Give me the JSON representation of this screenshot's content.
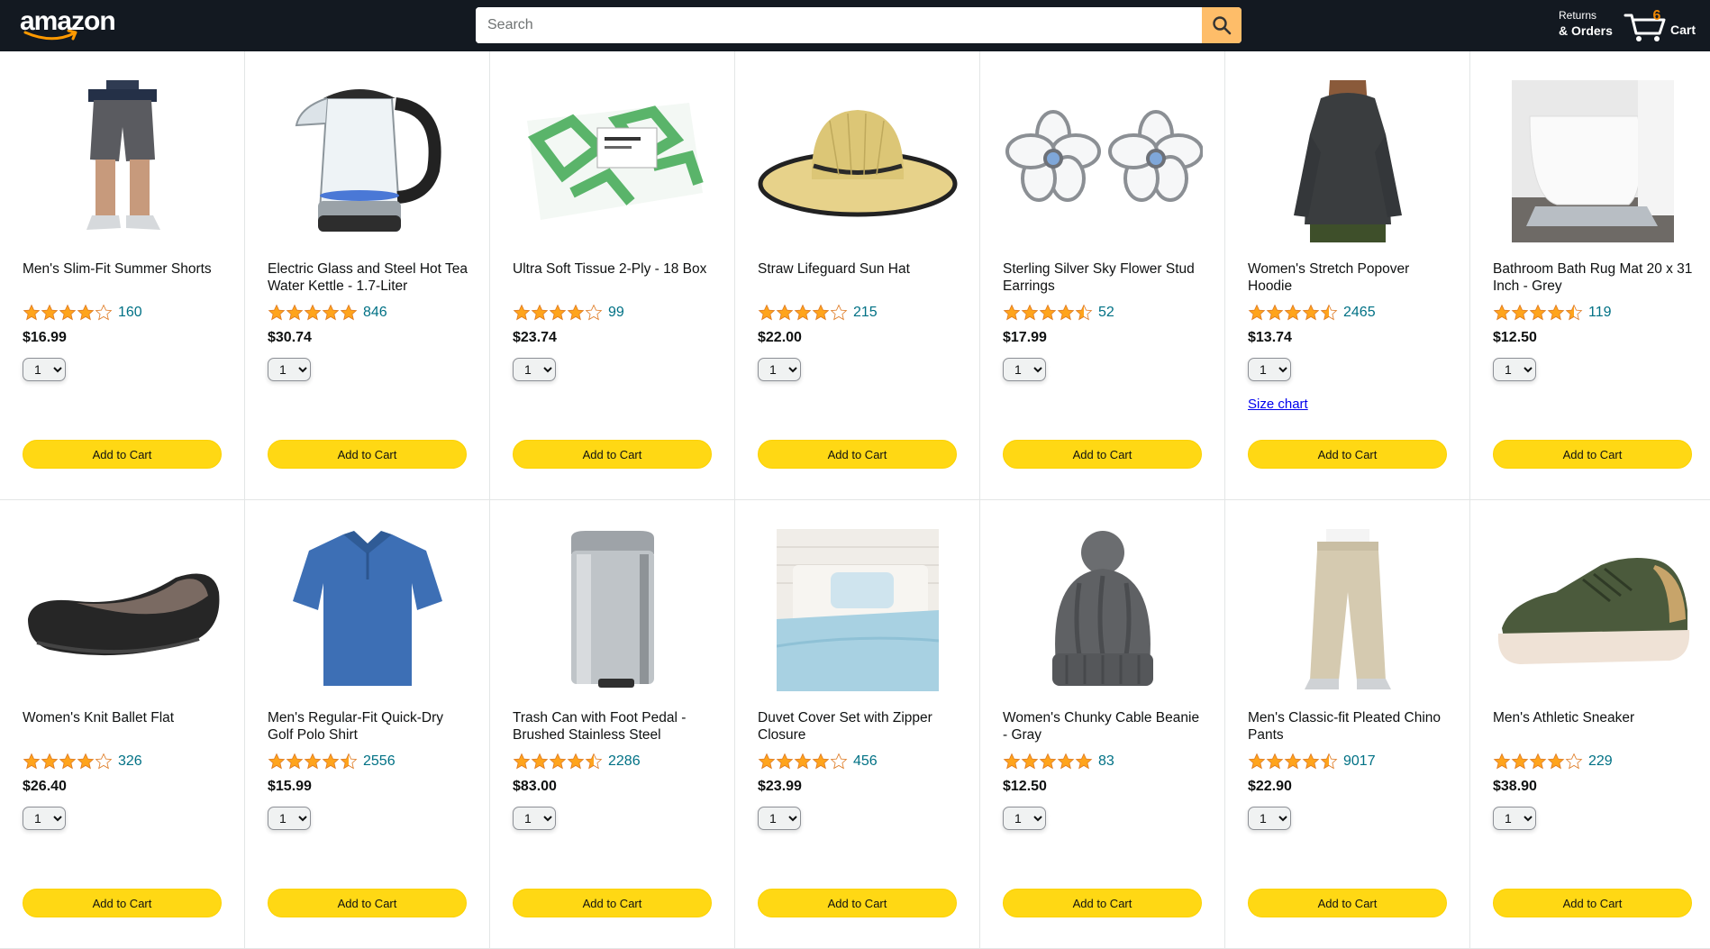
{
  "header": {
    "logo_text": "amazon",
    "search_placeholder": "Search",
    "returns_line1": "Returns",
    "returns_line2": "& Orders",
    "cart_count": "6",
    "cart_label": "Cart"
  },
  "colors": {
    "header_bg": "#131921",
    "search_button": "#febd69",
    "add_to_cart": "#ffd814",
    "star": "#ffa41c",
    "link": "#007185",
    "cart_count": "#f08804"
  },
  "add_to_cart_label": "Add to Cart",
  "products": [
    {
      "title": "Men's Slim-Fit Summer Shorts",
      "rating": 4,
      "reviews": "160",
      "price": "$16.99",
      "qty": "1",
      "image": "shorts-image",
      "size_chart": ""
    },
    {
      "title": "Electric Glass and Steel Hot Tea Water Kettle - 1.7-Liter",
      "rating": 5,
      "reviews": "846",
      "price": "$30.74",
      "qty": "1",
      "image": "kettle-image",
      "size_chart": ""
    },
    {
      "title": "Ultra Soft Tissue 2-Ply - 18 Box",
      "rating": 4,
      "reviews": "99",
      "price": "$23.74",
      "qty": "1",
      "image": "tissue-box-image",
      "size_chart": ""
    },
    {
      "title": "Straw Lifeguard Sun Hat",
      "rating": 4,
      "reviews": "215",
      "price": "$22.00",
      "qty": "1",
      "image": "sun-hat-image",
      "size_chart": ""
    },
    {
      "title": "Sterling Silver Sky Flower Stud Earrings",
      "rating": 4.5,
      "reviews": "52",
      "price": "$17.99",
      "qty": "1",
      "image": "earrings-image",
      "size_chart": ""
    },
    {
      "title": "Women's Stretch Popover Hoodie",
      "rating": 4.5,
      "reviews": "2465",
      "price": "$13.74",
      "qty": "1",
      "image": "hoodie-image",
      "size_chart": "Size chart"
    },
    {
      "title": "Bathroom Bath Rug Mat 20 x 31 Inch - Grey",
      "rating": 4.5,
      "reviews": "119",
      "price": "$12.50",
      "qty": "1",
      "image": "bath-rug-image",
      "size_chart": ""
    },
    {
      "title": "Women's Knit Ballet Flat",
      "rating": 4,
      "reviews": "326",
      "price": "$26.40",
      "qty": "1",
      "image": "ballet-flat-image",
      "size_chart": ""
    },
    {
      "title": "Men's Regular-Fit Quick-Dry Golf Polo Shirt",
      "rating": 4.5,
      "reviews": "2556",
      "price": "$15.99",
      "qty": "1",
      "image": "polo-shirt-image",
      "size_chart": ""
    },
    {
      "title": "Trash Can with Foot Pedal - Brushed Stainless Steel",
      "rating": 4.5,
      "reviews": "2286",
      "price": "$83.00",
      "qty": "1",
      "image": "trash-can-image",
      "size_chart": ""
    },
    {
      "title": "Duvet Cover Set with Zipper Closure",
      "rating": 4,
      "reviews": "456",
      "price": "$23.99",
      "qty": "1",
      "image": "duvet-set-image",
      "size_chart": ""
    },
    {
      "title": "Women's Chunky Cable Beanie - Gray",
      "rating": 5,
      "reviews": "83",
      "price": "$12.50",
      "qty": "1",
      "image": "beanie-image",
      "size_chart": ""
    },
    {
      "title": "Men's Classic-fit Pleated Chino Pants",
      "rating": 4.5,
      "reviews": "9017",
      "price": "$22.90",
      "qty": "1",
      "image": "chino-pants-image",
      "size_chart": ""
    },
    {
      "title": "Men's Athletic Sneaker",
      "rating": 4,
      "reviews": "229",
      "price": "$38.90",
      "qty": "1",
      "image": "sneaker-image",
      "size_chart": ""
    }
  ]
}
